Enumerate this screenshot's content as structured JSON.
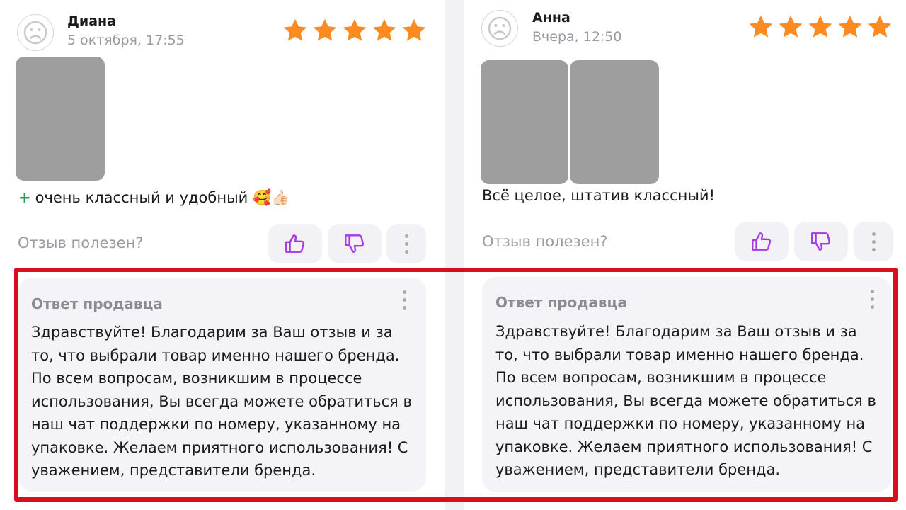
{
  "reviews": [
    {
      "author": "Диана",
      "date": "5 октября, 17:55",
      "rating": 5,
      "photos_count": 1,
      "text_prefix": "+",
      "text": "очень классный и удобный 🥰👍🏻",
      "helpful_label": "Отзыв полезен?",
      "icons": {
        "avatar": "sad-face-avatar-icon",
        "like": "thumbs-up-icon",
        "dislike": "thumbs-down-icon",
        "more": "more-vertical-icon"
      },
      "reply": {
        "title": "Ответ продавца",
        "text": "Здравствуйте! Благодарим за Ваш отзыв и за то, что выбрали товар  именно нашего бренда. По всем вопросам, возникшим в процессе использования, Вы всегда можете обратиться в наш чат поддержки по номеру, указанному на упаковке. Желаем приятного использования! С уважением, представители бренда."
      }
    },
    {
      "author": "Анна",
      "date": "Вчера, 12:50",
      "rating": 5,
      "photos_count": 2,
      "text": "Всё целое, штатив классный!",
      "helpful_label": "Отзыв полезен?",
      "icons": {
        "avatar": "sad-face-avatar-icon",
        "like": "thumbs-up-icon",
        "dislike": "thumbs-down-icon",
        "more": "more-vertical-icon"
      },
      "reply": {
        "title": "Ответ продавца",
        "text": "Здравствуйте! Благодарим за Ваш отзыв и за то, что выбрали товар  именно нашего бренда. По всем вопросам, возникшим в процессе использования, Вы всегда можете обратиться в наш чат поддержки по номеру, указанному на упаковке. Желаем приятного использования! С уважением, представители бренда."
      }
    }
  ],
  "colors": {
    "star": "#ff8a1f",
    "vote_icon": "#a73ae0",
    "highlight_border": "#d5101c",
    "plus": "#20a34a"
  }
}
